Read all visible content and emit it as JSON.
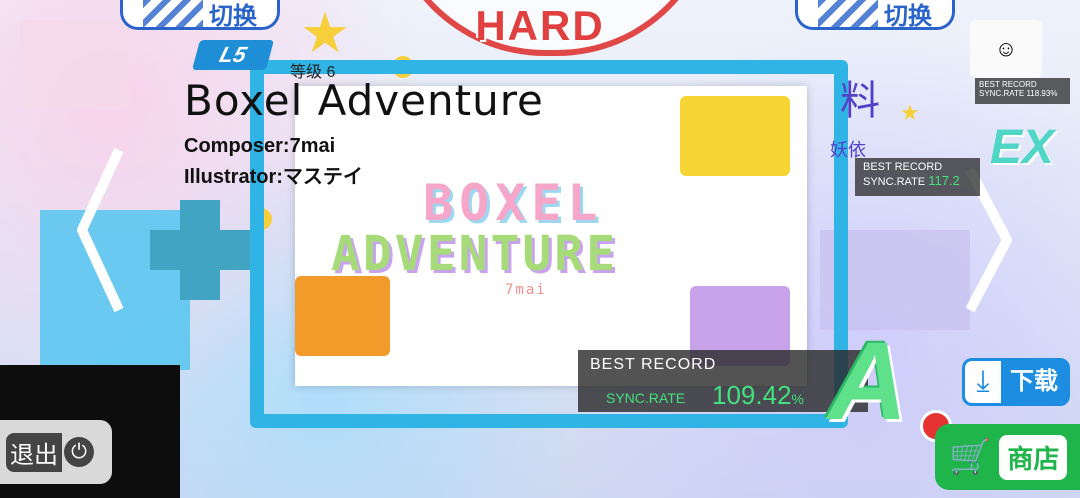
{
  "top": {
    "switch_left": "切换",
    "switch_right": "切换",
    "difficulty": "HARD"
  },
  "song": {
    "level_badge": "L5",
    "level_text": "等级 6",
    "title": "Boxel Adventure",
    "composer": "Composer:7mai",
    "illustrator": "Illustrator:マステイ"
  },
  "cover": {
    "line1": "BOXEL",
    "line2": "ADVENTURE",
    "artist": "7mai"
  },
  "best_record": {
    "label": "BEST RECORD",
    "sync_label": "SYNC.RATE",
    "rate": "109.42",
    "rate_unit": "%",
    "grade": "A"
  },
  "neighbor_right": {
    "label": "BEST RECORD",
    "sync_label": "SYNC.RATE",
    "rate": "117.2",
    "grade": "EX",
    "title_partial": "料",
    "subtitle_partial": "妖依"
  },
  "neighbor_far": {
    "label": "BEST RECORD",
    "sync_label": "SYNC.RATE",
    "rate": "118.93%"
  },
  "buttons": {
    "exit": "退出",
    "download": "下载",
    "shop": "商店"
  },
  "colors": {
    "accent_blue": "#2a63c9",
    "difficulty_red": "#e04040",
    "sync_green": "#42e17d",
    "shop_green": "#1fb54a"
  }
}
